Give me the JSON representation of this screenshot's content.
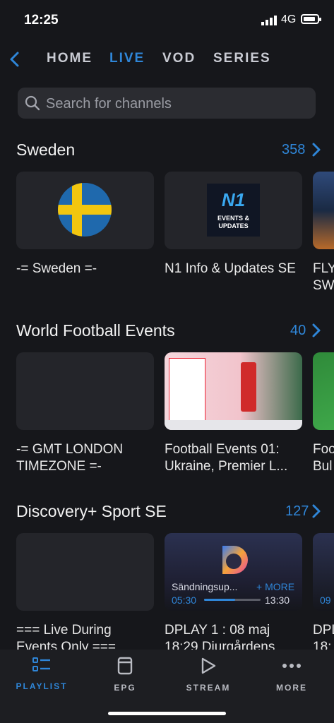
{
  "status": {
    "time": "12:25",
    "network": "4G"
  },
  "nav": {
    "tabs": [
      "HOME",
      "LIVE",
      "VOD",
      "SERIES"
    ],
    "active": "LIVE"
  },
  "search": {
    "placeholder": "Search for channels"
  },
  "sections": [
    {
      "title": "Sweden",
      "count": "358",
      "cards": [
        {
          "label": "-= Sweden =-",
          "icon": "sweden-flag"
        },
        {
          "label": "N1 Info & Updates SE",
          "logo_title": "N1",
          "logo_sub": "EVENTS & UPDATES"
        },
        {
          "label": "FLY SW"
        }
      ]
    },
    {
      "title": "World Football Events",
      "count": "40",
      "cards": [
        {
          "label": "-= GMT LONDON TIMEZONE =-"
        },
        {
          "label": "Football Events 01: Ukraine, Premier L..."
        },
        {
          "label": "Foo Bul"
        }
      ]
    },
    {
      "title": "Discovery+ Sport SE",
      "count": "127",
      "cards": [
        {
          "label": "=== Live During Events Only ==="
        },
        {
          "label": "DPLAY 1 : 08 maj 18:29 Djurgårdens",
          "overlay_title": "Sändningsup...",
          "more": "+ MORE",
          "start": "05:30",
          "end": "13:30",
          "progress": 0.55
        },
        {
          "label": "DPL 18:",
          "time": "09"
        }
      ]
    }
  ],
  "bottom_nav": [
    {
      "label": "PLAYLIST",
      "icon": "playlist-icon",
      "active": true
    },
    {
      "label": "EPG",
      "icon": "epg-icon"
    },
    {
      "label": "STREAM",
      "icon": "play-icon"
    },
    {
      "label": "MORE",
      "icon": "more-dots-icon"
    }
  ],
  "colors": {
    "accent": "#2f86d8",
    "background": "#16171b",
    "card": "#24252a"
  }
}
